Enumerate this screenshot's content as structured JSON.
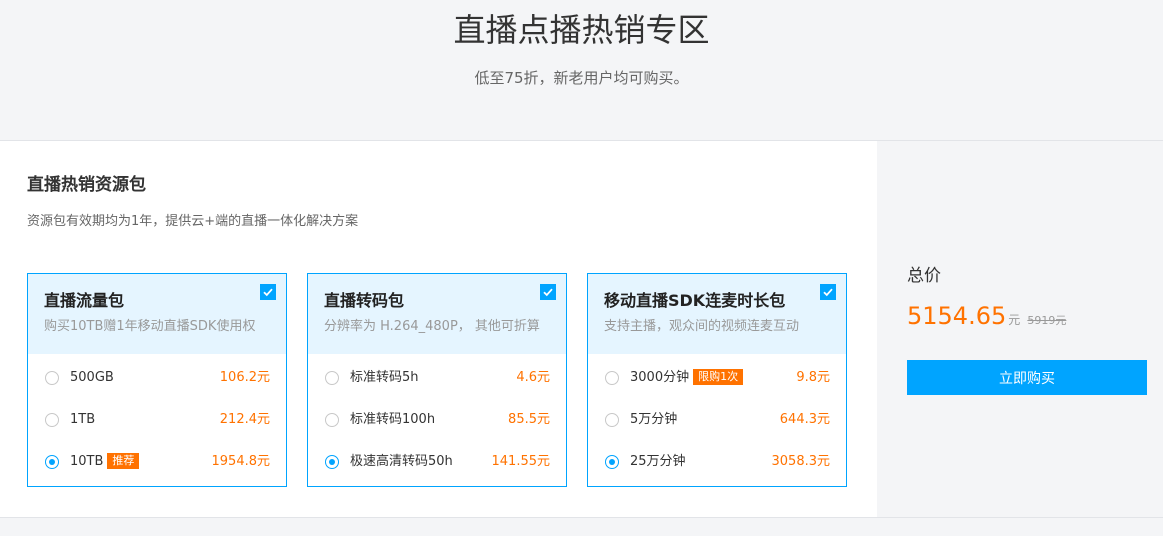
{
  "hero": {
    "title": "直播点播热销专区",
    "subtitle": "低至75折，新老用户均可购买。"
  },
  "section": {
    "title": "直播热销资源包",
    "description": "资源包有效期均为1年，提供云+端的直播一体化解决方案"
  },
  "cards": [
    {
      "name": "直播流量包",
      "description": "购买10TB赠1年移动直播SDK使用权",
      "checked": true,
      "options": [
        {
          "label": "500GB",
          "badge": "",
          "price": "106.2元",
          "selected": false
        },
        {
          "label": "1TB",
          "badge": "",
          "price": "212.4元",
          "selected": false
        },
        {
          "label": "10TB",
          "badge": "推荐",
          "price": "1954.8元",
          "selected": true
        }
      ]
    },
    {
      "name": "直播转码包",
      "description": "分辨率为 H.264_480P， 其他可折算",
      "checked": true,
      "options": [
        {
          "label": "标准转码5h",
          "badge": "",
          "price": "4.6元",
          "selected": false
        },
        {
          "label": "标准转码100h",
          "badge": "",
          "price": "85.5元",
          "selected": false
        },
        {
          "label": "极速高清转码50h",
          "badge": "",
          "price": "141.55元",
          "selected": true
        }
      ]
    },
    {
      "name": "移动直播SDK连麦时长包",
      "description": "支持主播，观众间的视频连麦互动",
      "checked": true,
      "options": [
        {
          "label": "3000分钟",
          "badge": "限购1次",
          "price": "9.8元",
          "selected": false
        },
        {
          "label": "5万分钟",
          "badge": "",
          "price": "644.3元",
          "selected": false
        },
        {
          "label": "25万分钟",
          "badge": "",
          "price": "3058.3元",
          "selected": true
        }
      ]
    }
  ],
  "summary": {
    "total_label": "总价",
    "total_price": "5154.65",
    "unit": "元",
    "original_price": "5919元",
    "buy_label": "立即购买"
  },
  "colors": {
    "accent": "#00a4ff",
    "price": "#ff7200",
    "card_head_bg": "#e5f5ff"
  },
  "icons": {
    "card_checkbox": "checkmark-icon"
  }
}
